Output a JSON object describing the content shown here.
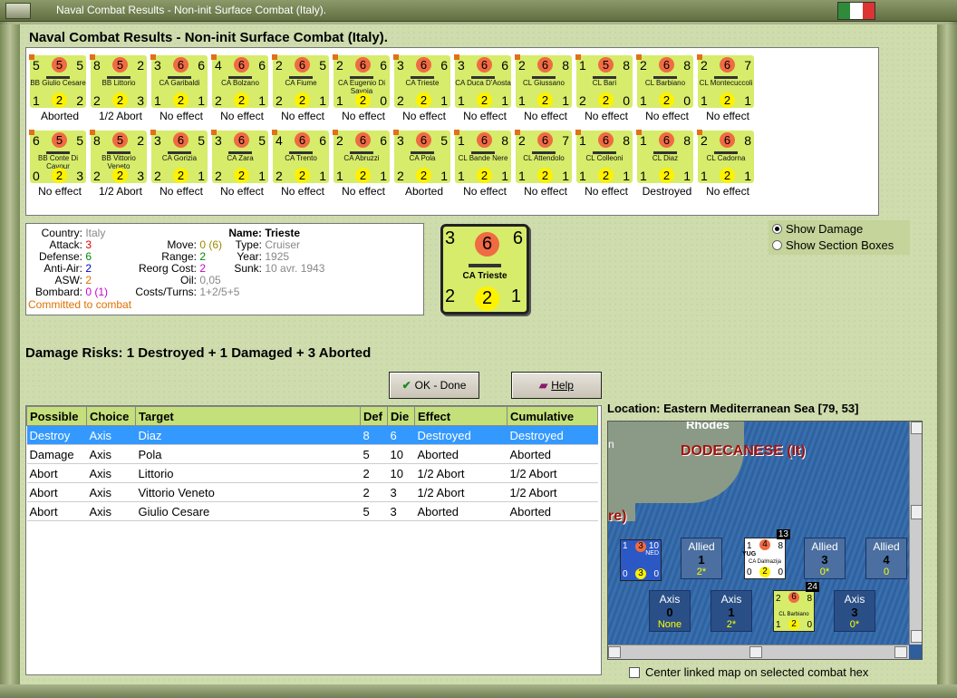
{
  "window": {
    "title": "Naval Combat Results - Non-init Surface Combat (Italy)."
  },
  "heading": "Naval Combat Results - Non-init Surface Combat (Italy).",
  "counters_row1": [
    {
      "tl": "5",
      "red": "5",
      "tr": "5",
      "name": "BB Giulio Cesare",
      "bl": "1",
      "yel": "2",
      "br": "2",
      "result": "Aborted"
    },
    {
      "tl": "8",
      "red": "5",
      "tr": "2",
      "name": "BB Littorio",
      "bl": "2",
      "yel": "2",
      "br": "3",
      "result": "1/2 Abort"
    },
    {
      "tl": "3",
      "red": "6",
      "tr": "6",
      "name": "CA Garibaldi",
      "bl": "1",
      "yel": "2",
      "br": "1",
      "result": "No effect"
    },
    {
      "tl": "4",
      "red": "6",
      "tr": "6",
      "name": "CA Bolzano",
      "bl": "2",
      "yel": "2",
      "br": "1",
      "result": "No effect"
    },
    {
      "tl": "2",
      "red": "6",
      "tr": "5",
      "name": "CA Fiume",
      "bl": "2",
      "yel": "2",
      "br": "1",
      "result": "No effect"
    },
    {
      "tl": "2",
      "red": "6",
      "tr": "6",
      "name": "CA Eugenio Di Savoia",
      "bl": "1",
      "yel": "2",
      "br": "0",
      "result": "No effect"
    },
    {
      "tl": "3",
      "red": "6",
      "tr": "6",
      "name": "CA Trieste",
      "bl": "2",
      "yel": "2",
      "br": "1",
      "result": "No effect"
    },
    {
      "tl": "3",
      "red": "6",
      "tr": "6",
      "name": "CA Duca D'Aosta",
      "bl": "1",
      "yel": "2",
      "br": "1",
      "result": "No effect"
    },
    {
      "tl": "2",
      "red": "6",
      "tr": "8",
      "name": "CL Giussano",
      "bl": "1",
      "yel": "2",
      "br": "1",
      "result": "No effect"
    },
    {
      "tl": "1",
      "red": "5",
      "tr": "8",
      "name": "CL Bari",
      "bl": "2",
      "yel": "2",
      "br": "0",
      "result": "No effect"
    },
    {
      "tl": "2",
      "red": "6",
      "tr": "8",
      "name": "CL Barbiano",
      "bl": "1",
      "yel": "2",
      "br": "0",
      "result": "No effect"
    },
    {
      "tl": "2",
      "red": "6",
      "tr": "7",
      "name": "CL Montecuccoli",
      "bl": "1",
      "yel": "2",
      "br": "1",
      "result": "No effect"
    }
  ],
  "counters_row2": [
    {
      "tl": "6",
      "red": "5",
      "tr": "5",
      "name": "BB Conte Di Cavour",
      "bl": "0",
      "yel": "2",
      "br": "3",
      "result": "No effect"
    },
    {
      "tl": "8",
      "red": "5",
      "tr": "2",
      "name": "BB Vittorio Veneto",
      "bl": "2",
      "yel": "2",
      "br": "3",
      "result": "1/2 Abort"
    },
    {
      "tl": "3",
      "red": "6",
      "tr": "5",
      "name": "CA Gorizia",
      "bl": "2",
      "yel": "2",
      "br": "1",
      "result": "No effect"
    },
    {
      "tl": "3",
      "red": "6",
      "tr": "5",
      "name": "CA Zara",
      "bl": "2",
      "yel": "2",
      "br": "1",
      "result": "No effect"
    },
    {
      "tl": "4",
      "red": "6",
      "tr": "6",
      "name": "CA Trento",
      "bl": "2",
      "yel": "2",
      "br": "1",
      "result": "No effect"
    },
    {
      "tl": "2",
      "red": "6",
      "tr": "6",
      "name": "CA Abruzzi",
      "bl": "1",
      "yel": "2",
      "br": "1",
      "result": "No effect"
    },
    {
      "tl": "3",
      "red": "6",
      "tr": "5",
      "name": "CA Pola",
      "bl": "2",
      "yel": "2",
      "br": "1",
      "result": "Aborted"
    },
    {
      "tl": "1",
      "red": "6",
      "tr": "8",
      "name": "CL Bande Nere",
      "bl": "1",
      "yel": "2",
      "br": "1",
      "result": "No effect"
    },
    {
      "tl": "2",
      "red": "6",
      "tr": "7",
      "name": "CL Attendolo",
      "bl": "1",
      "yel": "2",
      "br": "1",
      "result": "No effect"
    },
    {
      "tl": "1",
      "red": "6",
      "tr": "8",
      "name": "CL Colleoni",
      "bl": "1",
      "yel": "2",
      "br": "1",
      "result": "No effect"
    },
    {
      "tl": "1",
      "red": "6",
      "tr": "8",
      "name": "CL Diaz",
      "bl": "1",
      "yel": "2",
      "br": "1",
      "result": "Destroyed"
    },
    {
      "tl": "2",
      "red": "6",
      "tr": "8",
      "name": "CL Cadorna",
      "bl": "1",
      "yel": "2",
      "br": "1",
      "result": "No effect"
    }
  ],
  "info": {
    "country_label": "Country:",
    "country": "Italy",
    "attack_label": "Attack:",
    "attack": "3",
    "defense_label": "Defense:",
    "defense": "6",
    "antiair_label": "Anti-Air:",
    "antiair": "2",
    "asw_label": "ASW:",
    "asw": "2",
    "bombard_label": "Bombard:",
    "bombard": "0 (1)",
    "move_label": "Move:",
    "move": "0 (6)",
    "range_label": "Range:",
    "range": "2",
    "reorg_label": "Reorg Cost:",
    "reorg": "2",
    "oil_label": "Oil:",
    "oil": "0,05",
    "costs_label": "Costs/Turns:",
    "costs": "1+2/5+5",
    "name_label": "Name:",
    "name": "Trieste",
    "type_label": "Type:",
    "type": "Cruiser",
    "year_label": "Year:",
    "year": "1925",
    "sunk_label": "Sunk:",
    "sunk": "10 avr. 1943",
    "status": "Committed to combat"
  },
  "big_counter": {
    "tl": "3",
    "red": "6",
    "tr": "6",
    "name": "CA Trieste",
    "bl": "2",
    "yel": "2",
    "br": "1"
  },
  "options": {
    "show_damage": "Show Damage",
    "show_section": "Show Section Boxes"
  },
  "damage_risks": "Damage Risks:  1 Destroyed + 1 Damaged + 3 Aborted",
  "buttons": {
    "ok": "OK - Done",
    "help": "Help"
  },
  "table": {
    "headers": [
      "Possible",
      "Choice",
      "Target",
      "Def",
      "Die",
      "Effect",
      "Cumulative"
    ],
    "rows": [
      [
        "Destroy",
        "Axis",
        "Diaz",
        "8",
        "6",
        "Destroyed",
        "Destroyed"
      ],
      [
        "Damage",
        "Axis",
        "Pola",
        "5",
        "10",
        "Aborted",
        "Aborted"
      ],
      [
        "Abort",
        "Axis",
        "Littorio",
        "2",
        "10",
        "1/2 Abort",
        "1/2 Abort"
      ],
      [
        "Abort",
        "Axis",
        "Vittorio Veneto",
        "2",
        "3",
        "1/2 Abort",
        "1/2 Abort"
      ],
      [
        "Abort",
        "Axis",
        "Giulio Cesare",
        "5",
        "3",
        "Aborted",
        "Aborted"
      ]
    ]
  },
  "location": "Location:  Eastern Mediterranean Sea [79, 53]",
  "map": {
    "rhodes": "Rhodes",
    "dodecanese": "DODECANESE (It)",
    "re": "re)",
    "n": "n",
    "allied1": {
      "t": "Allied",
      "n": "1",
      "s": "2*"
    },
    "allied2": {
      "t": "Allied",
      "n": "3",
      "s": "0*"
    },
    "allied3": {
      "t": "Allied",
      "n": "4",
      "s": "0"
    },
    "axis1": {
      "t": "Axis",
      "n": "0",
      "s": "None"
    },
    "axis2": {
      "t": "Axis",
      "n": "1",
      "s": "2*"
    },
    "axis3": {
      "t": "Axis",
      "n": "3",
      "s": "0*"
    },
    "mc1": {
      "tl": "1",
      "red": "3",
      "tr": "10",
      "bl": "0",
      "yel": "3",
      "br": "0",
      "tag": "NED"
    },
    "mc2": {
      "tl": "1",
      "red": "4",
      "tr": "8",
      "name": "CA Dalmazija",
      "bl": "0",
      "yel": "2",
      "br": "0",
      "tag": "YUG",
      "stack": "13"
    },
    "mc3": {
      "tl": "2",
      "red": "6",
      "tr": "8",
      "name": "CL Barbiano",
      "bl": "1",
      "yel": "2",
      "br": "0",
      "stack": "24"
    }
  },
  "center_checkbox": "Center linked map on selected combat hex"
}
